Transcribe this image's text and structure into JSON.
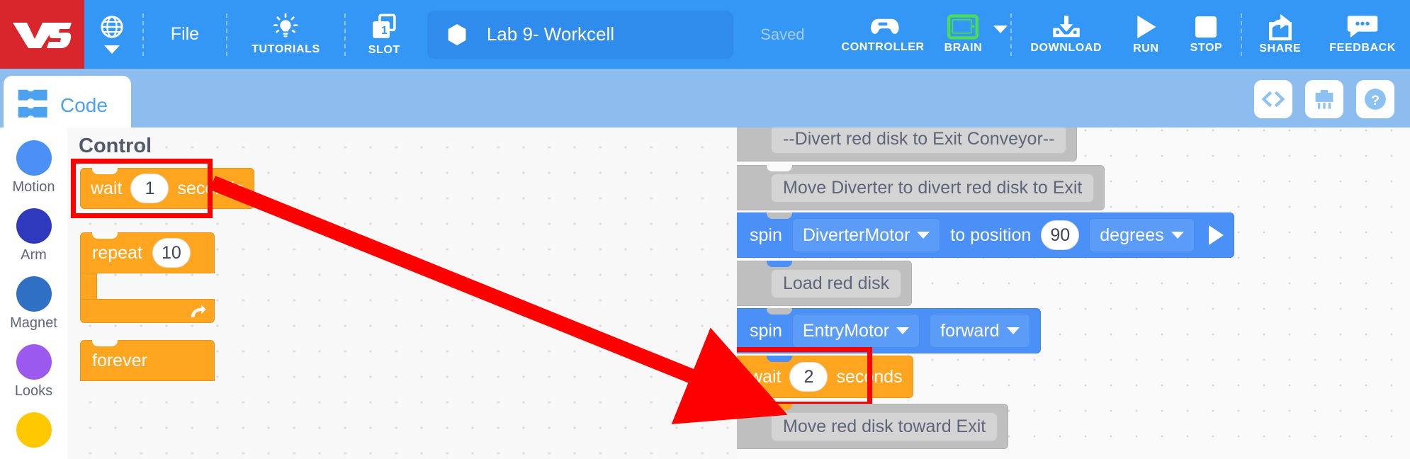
{
  "toolbar": {
    "logo_text": "V5",
    "language_icon": "globe-icon",
    "file_label": "File",
    "tutorials_label": "TUTORIALS",
    "tutorials_icon": "lightbulb-icon",
    "slot_label": "SLOT",
    "slot_number": "1",
    "project_name": "Lab 9- Workcell",
    "project_icon": "hexagon-icon",
    "save_status": "Saved",
    "controller_label": "CONTROLLER",
    "controller_icon": "gamepad-icon",
    "brain_label": "BRAIN",
    "brain_icon": "brain-device-icon",
    "download_label": "DOWNLOAD",
    "download_icon": "download-icon",
    "run_label": "RUN",
    "run_icon": "play-icon",
    "stop_label": "STOP",
    "stop_icon": "stop-square-icon",
    "share_label": "SHARE",
    "share_icon": "share-icon",
    "feedback_label": "FEEDBACK",
    "feedback_icon": "speech-bubble-icon"
  },
  "subbar": {
    "code_tab_label": "Code",
    "code_tab_icon": "blocks-icon",
    "buttons": [
      {
        "name": "view-code-button",
        "icon": "code-brackets-icon",
        "glyph": "<>"
      },
      {
        "name": "device-info-button",
        "icon": "brain-device-icon",
        "glyph": ""
      },
      {
        "name": "help-button",
        "icon": "question-mark-icon",
        "glyph": "?"
      }
    ]
  },
  "sidebar": {
    "items": [
      {
        "label": "Motion",
        "color": "#4a90f7"
      },
      {
        "label": "Arm",
        "color": "#2f39bd"
      },
      {
        "label": "Magnet",
        "color": "#2f6fc4"
      },
      {
        "label": "Looks",
        "color": "#9b59f0"
      },
      {
        "label": "",
        "color": "#ffc800"
      }
    ]
  },
  "palette": {
    "title": "Control",
    "blocks": {
      "wait": {
        "pre": "wait",
        "value": "1",
        "post": "seconds"
      },
      "repeat": {
        "label": "repeat",
        "value": "10"
      },
      "forever": {
        "label": "forever"
      }
    }
  },
  "workspace": {
    "blocks": [
      {
        "type": "comment",
        "text": "--Divert red disk to Exit Conveyor--"
      },
      {
        "type": "comment",
        "text": "Move Diverter to divert red disk to Exit"
      },
      {
        "type": "spin-position",
        "pre": "spin",
        "motor": "DiverterMotor",
        "mid": "to position",
        "value": "90",
        "units": "degrees"
      },
      {
        "type": "comment",
        "text": "Load red disk"
      },
      {
        "type": "spin-direction",
        "pre": "spin",
        "motor": "EntryMotor",
        "direction": "forward"
      },
      {
        "type": "wait",
        "pre": "wait",
        "value": "2",
        "post": "seconds"
      },
      {
        "type": "comment",
        "text": "Move red disk toward Exit"
      }
    ]
  },
  "annotations": {
    "highlight_color": "#ff0000",
    "arrow_from": "palette wait 1 seconds block",
    "arrow_to": "workspace wait 2 seconds block"
  },
  "colors": {
    "brand_red": "#d9262c",
    "toolbar_blue": "#3496f5",
    "subbar_blue": "#8cbdee",
    "control_orange": "#ffa51f",
    "motion_blue": "#4a90f7",
    "comment_gray": "#bfbfbf"
  }
}
